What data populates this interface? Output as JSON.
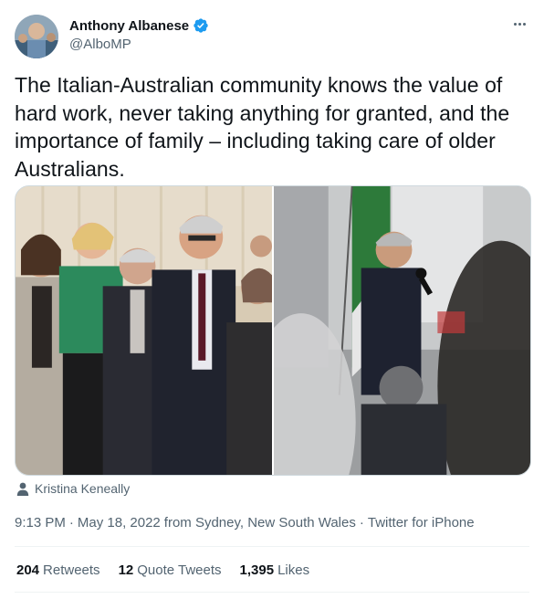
{
  "author": {
    "name": "Anthony Albanese",
    "handle": "@AlboMP",
    "verified": true
  },
  "tweet": {
    "text": "The Italian-Australian community knows the value of hard work, never taking anything for granted, and the importance of family – including taking care of older Australians."
  },
  "media": {
    "photos": [
      {
        "icon": "group-photo"
      },
      {
        "icon": "speech-photo"
      }
    ],
    "tagged_person": "Kristina Keneally"
  },
  "meta": {
    "time": "9:13 PM",
    "date": "May 18, 2022",
    "location": "from Sydney, New South Wales",
    "source": "Twitter for iPhone",
    "separator": "·"
  },
  "stats": {
    "retweets_count": "204",
    "retweets_label": "Retweets",
    "quotes_count": "12",
    "quotes_label": "Quote Tweets",
    "likes_count": "1,395",
    "likes_label": "Likes"
  },
  "colors": {
    "text": "#0f1419",
    "secondary": "#536471",
    "verified": "#1d9bf0",
    "divider": "#eff3f4"
  }
}
